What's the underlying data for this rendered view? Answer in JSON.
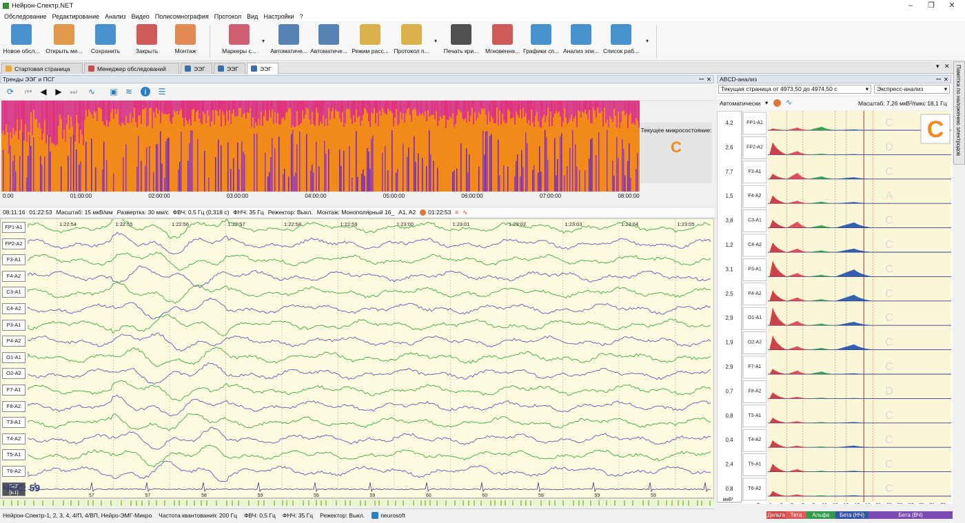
{
  "window": {
    "title": "Нейрон-Спектр.NET"
  },
  "menu": [
    "Обследование",
    "Редактирование",
    "Анализ",
    "Видео",
    "Полисомнография",
    "Протокол",
    "Вид",
    "Настройки",
    "?"
  ],
  "toolbar": [
    {
      "label": "Новое обсл...",
      "icon": "new-exam-icon",
      "color": "#2a7fc4"
    },
    {
      "label": "Открыть ме...",
      "icon": "open-icon",
      "color": "#d98a2b"
    },
    {
      "label": "Сохранить",
      "icon": "save-icon",
      "color": "#2a7fc4"
    },
    {
      "label": "Закрыть",
      "icon": "close-exam-icon",
      "color": "#c83e3e"
    },
    {
      "label": "Монтаж",
      "icon": "montage-icon",
      "color": "#e0773a"
    },
    {
      "label": "Маркеры с...",
      "icon": "markers-icon",
      "color": "#c8455a"
    },
    {
      "label": "Автоматиче...",
      "icon": "auto-analysis-icon",
      "color": "#3a6ea8"
    },
    {
      "label": "Автоматиче...",
      "icon": "auto-analysis-2-icon",
      "color": "#3a6ea8"
    },
    {
      "label": "Режим расс...",
      "icon": "view-mode-icon",
      "color": "#d7a42e"
    },
    {
      "label": "Протокол п...",
      "icon": "protocol-icon",
      "color": "#d7a42e"
    },
    {
      "label": "Печать кри...",
      "icon": "print-icon",
      "color": "#333333"
    },
    {
      "label": "Мгновенна...",
      "icon": "instant-icon",
      "color": "#c83e3e"
    },
    {
      "label": "Графики сп...",
      "icon": "spectrum-graphs-icon",
      "color": "#2a7fc4"
    },
    {
      "label": "Анализ эпи...",
      "icon": "epi-analysis-icon",
      "color": "#2a7fc4"
    },
    {
      "label": "Список раб...",
      "icon": "worklist-icon",
      "color": "#2a7fc4"
    }
  ],
  "tabs": [
    {
      "label": "Стартовая страница"
    },
    {
      "label": "Менеджер обследований"
    },
    {
      "label": "ЭЭГ"
    },
    {
      "label": "ЭЭГ"
    },
    {
      "label": "ЭЭГ"
    }
  ],
  "left_panel": {
    "title": "Тренды ЭЭГ и ПСГ",
    "current_state_label": "Текущее микросостояние:",
    "current_state_value": "С",
    "time_ticks": [
      "0:00",
      "01:00:00",
      "02:00:00",
      "03:00:00",
      "04:00:00",
      "05:00:00",
      "06:00:00",
      "07:00:00",
      "08:00:00"
    ]
  },
  "params": {
    "time1": "08:11:16",
    "time2": "01:22:53",
    "scale": "Масштаб: 15 мкВ/мм",
    "sweep": "Развертка: 30 мм/с",
    "hpf": "ФВЧ: 0,5 Гц (0,318 с)",
    "lpf": "ФНЧ: 35 Гц",
    "notch": "Режектор: Выкл.",
    "montage": "Монтаж: Монополярный 16_",
    "ref": "A1, A2",
    "time3": "01:22:53"
  },
  "eeg": {
    "time_marks": [
      "1:22:54",
      "1:22:55",
      "1:22:56",
      "1:22:57",
      "1:22:58",
      "1:22:59",
      "1:23:00",
      "1:23:01",
      "1:23:02",
      "1:23:03",
      "1:23:04",
      "1:23:05"
    ],
    "channels": [
      "FP1-A1",
      "FP2-A2",
      "F3-A1",
      "F4-A2",
      "C3-A1",
      "C4-A2",
      "P3-A1",
      "P4-A2",
      "O1-A1",
      "O2-A2",
      "F7-A1",
      "F8-A2",
      "T3-A1",
      "T4-A2",
      "T5-A1",
      "T6-A2"
    ],
    "ecg_label": "ЭКГ",
    "ecg_sub": "[E1]",
    "hr_label": "ЧСС: 59",
    "hr_values": [
      "57",
      "57",
      "58",
      "59",
      "59",
      "59",
      "60",
      "60",
      "59",
      "59",
      "59"
    ],
    "colors": {
      "green": "#3aaa3a",
      "blue": "#5a5ab4"
    }
  },
  "status": {
    "device": "Нейрон-Спектр-1, 2, 3, 4, 4/П, 4/ВП, Нейро-ЭМГ-Микро",
    "sampling": "Частота квантования: 200 Гц",
    "hpf": "ФВЧ: 0,5 Гц",
    "lpf": "ФНЧ: 35 Гц",
    "notch": "Режектор: Выкл.",
    "user": "neurosoft"
  },
  "abcd": {
    "title": "ABCD-анализ",
    "page_select": "Текущая страница от 4973,50 до 4974,50 с",
    "mode_select": "Экспресс-анализ",
    "auto": "Автоматически",
    "scale_text": "Масштаб: 7,26 мкВ²/пикс  18,1 Гц",
    "big_letter": "C",
    "y_unit": "мкВ²",
    "x_unit": "Гц",
    "freq_ticks": [
      "1",
      "3",
      "5",
      "7",
      "9",
      "11",
      "13",
      "15",
      "17",
      "19",
      "21",
      "23",
      "25",
      "27",
      "29",
      "31",
      "33"
    ],
    "bands": [
      {
        "name": "Дельта",
        "color": "#d04545"
      },
      {
        "name": "Тета",
        "color": "#e05a5a"
      },
      {
        "name": "Альфа",
        "color": "#2e9a4a"
      },
      {
        "name": "Бета (НЧ)",
        "color": "#3356a8"
      },
      {
        "name": "Бета (ВЧ)",
        "color": "#7a4ab4"
      }
    ],
    "rows": [
      {
        "ch": "FP1-A1",
        "amp": "4,2",
        "letter": "C",
        "peaks": [
          0.1,
          0.15,
          0.2,
          0.05,
          0.0
        ]
      },
      {
        "ch": "FP2-A2",
        "amp": "2,6",
        "letter": "D",
        "peaks": [
          0.7,
          0.2,
          0.05,
          0.03,
          0.0
        ]
      },
      {
        "ch": "F3-A1",
        "amp": "7,7",
        "letter": "C",
        "peaks": [
          0.3,
          0.35,
          0.15,
          0.1,
          0.0
        ]
      },
      {
        "ch": "F4-A2",
        "amp": "1,5",
        "letter": "A",
        "peaks": [
          0.45,
          0.15,
          0.1,
          0.08,
          0.0
        ]
      },
      {
        "ch": "C3-A1",
        "amp": "3,8",
        "letter": "C",
        "peaks": [
          0.45,
          0.35,
          0.15,
          0.3,
          0.0
        ]
      },
      {
        "ch": "C4-A2",
        "amp": "1,2",
        "letter": "C",
        "peaks": [
          0.55,
          0.2,
          0.1,
          0.2,
          0.0
        ]
      },
      {
        "ch": "P3-A1",
        "amp": "3,1",
        "letter": "C",
        "peaks": [
          0.9,
          0.2,
          0.1,
          0.4,
          0.0
        ]
      },
      {
        "ch": "P4-A2",
        "amp": "2,5",
        "letter": "C",
        "peaks": [
          0.6,
          0.2,
          0.1,
          0.35,
          0.0
        ]
      },
      {
        "ch": "O1-A1",
        "amp": "2,9",
        "letter": "C",
        "peaks": [
          1.0,
          0.25,
          0.1,
          0.2,
          0.0
        ]
      },
      {
        "ch": "O2-A2",
        "amp": "1,9",
        "letter": "C",
        "peaks": [
          0.8,
          0.2,
          0.1,
          0.3,
          0.0
        ]
      },
      {
        "ch": "F7-A1",
        "amp": "2,9",
        "letter": "C",
        "peaks": [
          0.3,
          0.2,
          0.15,
          0.05,
          0.0
        ]
      },
      {
        "ch": "F8-A2",
        "amp": "0,7",
        "letter": "D",
        "peaks": [
          0.35,
          0.1,
          0.05,
          0.03,
          0.0
        ]
      },
      {
        "ch": "T3-A1",
        "amp": "0,8",
        "letter": "C",
        "peaks": [
          0.3,
          0.1,
          0.05,
          0.05,
          0.0
        ]
      },
      {
        "ch": "T4-A2",
        "amp": "0,4",
        "letter": "C",
        "peaks": [
          0.4,
          0.1,
          0.05,
          0.1,
          0.0
        ]
      },
      {
        "ch": "T5-A1",
        "amp": "2,4",
        "letter": "C",
        "peaks": [
          0.45,
          0.15,
          0.05,
          0.05,
          0.0
        ]
      },
      {
        "ch": "T6-A2",
        "amp": "0,8",
        "letter": "C",
        "peaks": [
          0.3,
          0.1,
          0.05,
          0.05,
          0.0
        ]
      }
    ]
  },
  "side_tab": "Памятка по наложению электродов"
}
